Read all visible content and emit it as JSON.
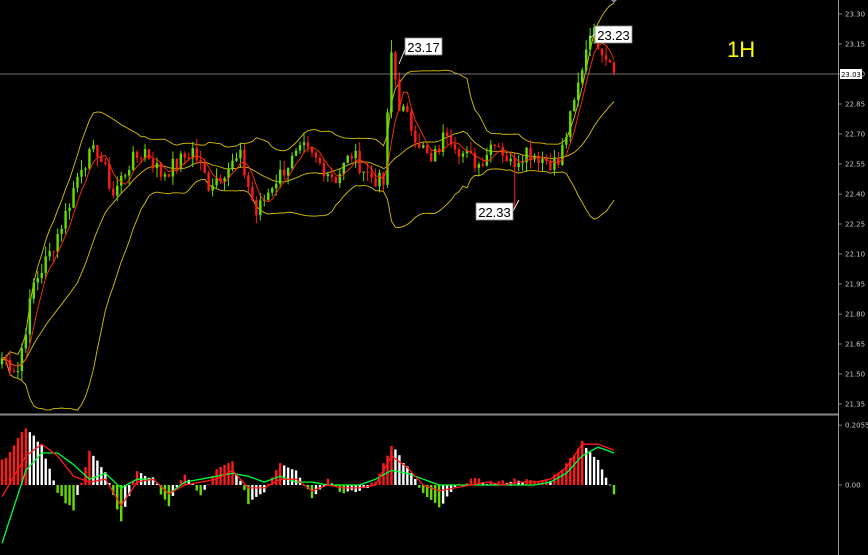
{
  "timeframe_label": "1H",
  "price_axis": {
    "ticks": [
      "23.30",
      "23.15",
      "23.00",
      "22.85",
      "22.70",
      "22.55",
      "22.40",
      "22.25",
      "22.10",
      "21.95",
      "21.80",
      "21.65",
      "21.50",
      "21.35"
    ],
    "current_price": "23.03"
  },
  "indicator_axis": {
    "ticks": [
      "0.2055",
      "0.00"
    ]
  },
  "annotations": {
    "high_1": "23.17",
    "low_1": "22.33",
    "high_2": "23.23"
  },
  "colors": {
    "background": "#000000",
    "bull_candle": "#66dd00",
    "bear_candle": "#ff1a1a",
    "bollinger": "#d8c000",
    "ma_line": "#ff3300",
    "macd_line": "#00ff33",
    "signal_line": "#ff1a1a",
    "axis_text": "#c8c8c8"
  },
  "chart_data": [
    {
      "type": "candlestick",
      "title": "",
      "ylim": [
        21.3,
        23.36
      ],
      "y_ticks": [
        23.3,
        23.15,
        23.0,
        22.85,
        22.7,
        22.55,
        22.4,
        22.25,
        22.1,
        21.95,
        21.8,
        21.65,
        21.5,
        21.35
      ],
      "current_price": 23.03,
      "close_path": [
        [
          0,
          21.58
        ],
        [
          4,
          21.52
        ],
        [
          8,
          21.95
        ],
        [
          12,
          22.1
        ],
        [
          16,
          22.3
        ],
        [
          20,
          22.55
        ],
        [
          24,
          22.62
        ],
        [
          28,
          22.4
        ],
        [
          32,
          22.55
        ],
        [
          36,
          22.62
        ],
        [
          40,
          22.5
        ],
        [
          44,
          22.55
        ],
        [
          48,
          22.62
        ],
        [
          52,
          22.45
        ],
        [
          56,
          22.52
        ],
        [
          60,
          22.58
        ],
        [
          64,
          22.3
        ],
        [
          68,
          22.45
        ],
        [
          72,
          22.55
        ],
        [
          76,
          22.62
        ],
        [
          80,
          22.55
        ],
        [
          84,
          22.48
        ],
        [
          88,
          22.6
        ],
        [
          92,
          22.5
        ],
        [
          96,
          22.45
        ],
        [
          98,
          23.1
        ],
        [
          100,
          22.85
        ],
        [
          104,
          22.7
        ],
        [
          108,
          22.55
        ],
        [
          112,
          22.72
        ],
        [
          116,
          22.6
        ],
        [
          120,
          22.55
        ],
        [
          124,
          22.68
        ],
        [
          128,
          22.55
        ],
        [
          132,
          22.62
        ],
        [
          136,
          22.58
        ],
        [
          140,
          22.55
        ],
        [
          144,
          22.85
        ],
        [
          148,
          23.23
        ],
        [
          152,
          23.1
        ],
        [
          154,
          23.05
        ]
      ],
      "annotations": [
        {
          "label": "23.17",
          "value": 23.17,
          "kind": "high"
        },
        {
          "label": "22.33",
          "value": 22.33,
          "kind": "low"
        },
        {
          "label": "23.23",
          "value": 23.23,
          "kind": "high"
        }
      ],
      "overlays": [
        "bollinger_upper",
        "bollinger_middle",
        "bollinger_lower",
        "moving_average"
      ]
    },
    {
      "type": "bar",
      "title": "",
      "ylim": [
        -0.23,
        0.23
      ],
      "y_ticks": [
        0.2055,
        0.0
      ],
      "histogram_path": [
        [
          0,
          0.08
        ],
        [
          6,
          0.2
        ],
        [
          10,
          0.14
        ],
        [
          14,
          -0.03
        ],
        [
          18,
          -0.09
        ],
        [
          22,
          0.12
        ],
        [
          26,
          0.04
        ],
        [
          30,
          -0.12
        ],
        [
          34,
          0.05
        ],
        [
          38,
          0.02
        ],
        [
          42,
          -0.07
        ],
        [
          46,
          0.04
        ],
        [
          50,
          -0.04
        ],
        [
          54,
          0.05
        ],
        [
          58,
          0.08
        ],
        [
          62,
          -0.06
        ],
        [
          66,
          -0.02
        ],
        [
          70,
          0.08
        ],
        [
          74,
          0.05
        ],
        [
          78,
          -0.04
        ],
        [
          82,
          0.02
        ],
        [
          86,
          -0.03
        ],
        [
          90,
          -0.02
        ],
        [
          94,
          0.01
        ],
        [
          98,
          0.14
        ],
        [
          102,
          0.06
        ],
        [
          106,
          -0.03
        ],
        [
          110,
          -0.08
        ],
        [
          114,
          -0.01
        ],
        [
          118,
          0.02
        ],
        [
          122,
          0.01
        ],
        [
          126,
          0.01
        ],
        [
          130,
          0.02
        ],
        [
          134,
          0.01
        ],
        [
          138,
          0.02
        ],
        [
          142,
          0.07
        ],
        [
          146,
          0.15
        ],
        [
          150,
          0.08
        ],
        [
          154,
          -0.03
        ]
      ],
      "series": [
        {
          "values_path": [
            [
              0,
              -0.2
            ],
            [
              6,
              0.05
            ],
            [
              10,
              0.11
            ],
            [
              14,
              0.11
            ],
            [
              18,
              0.07
            ],
            [
              22,
              0.02
            ],
            [
              26,
              0.04
            ],
            [
              30,
              -0.01
            ],
            [
              34,
              0.02
            ],
            [
              38,
              0.02
            ],
            [
              42,
              -0.03
            ],
            [
              46,
              0.01
            ],
            [
              50,
              0.02
            ],
            [
              54,
              0.03
            ],
            [
              58,
              0.04
            ],
            [
              62,
              0.03
            ],
            [
              66,
              0.01
            ],
            [
              70,
              0.03
            ],
            [
              74,
              0.01
            ],
            [
              78,
              0.01
            ],
            [
              82,
              0.0
            ],
            [
              86,
              0.0
            ],
            [
              90,
              0.0
            ],
            [
              94,
              0.02
            ],
            [
              98,
              0.05
            ],
            [
              102,
              0.04
            ],
            [
              106,
              0.02
            ],
            [
              110,
              0.0
            ],
            [
              114,
              0.0
            ],
            [
              118,
              0.0
            ],
            [
              122,
              0.0
            ],
            [
              126,
              0.0
            ],
            [
              130,
              0.0
            ],
            [
              134,
              0.0
            ],
            [
              138,
              0.01
            ],
            [
              142,
              0.04
            ],
            [
              146,
              0.1
            ],
            [
              150,
              0.13
            ],
            [
              154,
              0.11
            ]
          ]
        },
        {
          "values_path": [
            [
              0,
              -0.04
            ],
            [
              6,
              0.1
            ],
            [
              10,
              0.14
            ],
            [
              14,
              0.1
            ],
            [
              18,
              0.03
            ],
            [
              22,
              0.01
            ],
            [
              26,
              0.02
            ],
            [
              30,
              -0.07
            ],
            [
              34,
              0.01
            ],
            [
              38,
              0.02
            ],
            [
              42,
              -0.03
            ],
            [
              46,
              0.0
            ],
            [
              50,
              0.01
            ],
            [
              54,
              0.02
            ],
            [
              58,
              0.05
            ],
            [
              62,
              -0.01
            ],
            [
              66,
              -0.01
            ],
            [
              70,
              0.02
            ],
            [
              74,
              0.02
            ],
            [
              78,
              -0.02
            ],
            [
              82,
              0.0
            ],
            [
              86,
              -0.01
            ],
            [
              90,
              -0.01
            ],
            [
              94,
              0.0
            ],
            [
              98,
              0.1
            ],
            [
              102,
              0.06
            ],
            [
              106,
              0.0
            ],
            [
              110,
              -0.02
            ],
            [
              114,
              -0.01
            ],
            [
              118,
              0.0
            ],
            [
              122,
              0.01
            ],
            [
              126,
              0.0
            ],
            [
              130,
              0.01
            ],
            [
              134,
              0.01
            ],
            [
              138,
              0.02
            ],
            [
              142,
              0.06
            ],
            [
              146,
              0.14
            ],
            [
              150,
              0.14
            ],
            [
              154,
              0.12
            ]
          ]
        }
      ]
    }
  ]
}
